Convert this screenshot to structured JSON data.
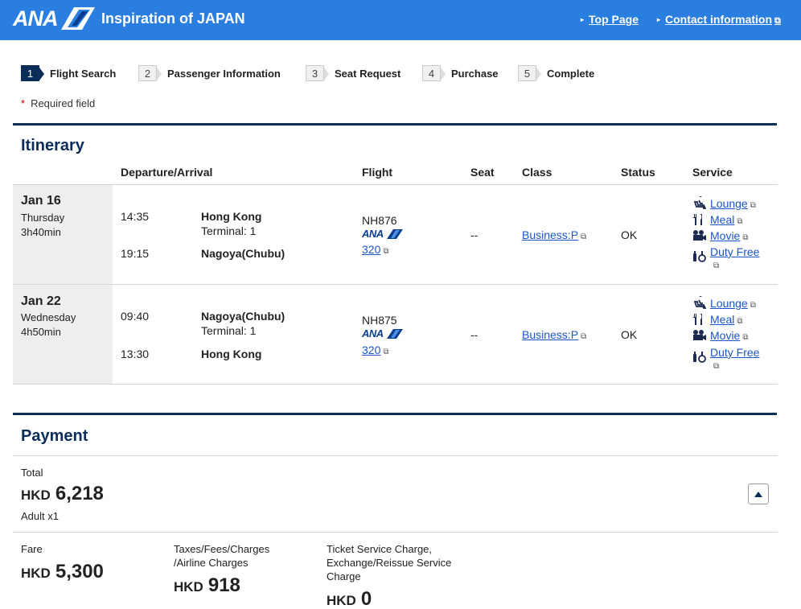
{
  "header": {
    "logo_text": "ANA",
    "tagline": "Inspiration of JAPAN",
    "links": {
      "top_page": "Top Page",
      "contact": "Contact information"
    }
  },
  "steps": [
    {
      "num": "1",
      "label": "Flight Search"
    },
    {
      "num": "2",
      "label": "Passenger Information"
    },
    {
      "num": "3",
      "label": "Seat Request"
    },
    {
      "num": "4",
      "label": "Purchase"
    },
    {
      "num": "5",
      "label": "Complete"
    }
  ],
  "required_note": {
    "star": "*",
    "text": "Required field"
  },
  "itinerary": {
    "title": "Itinerary",
    "headers": {
      "dep_arr": "Departure/Arrival",
      "flight": "Flight",
      "seat": "Seat",
      "class": "Class",
      "status": "Status",
      "service": "Service"
    },
    "segments": [
      {
        "date": "Jan 16",
        "day": "Thursday",
        "duration": "3h40min",
        "dep_time": "14:35",
        "dep_city": "Hong Kong",
        "terminal": "Terminal: 1",
        "arr_time": "19:15",
        "arr_city": "Nagoya(Chubu)",
        "flight_no": "NH876",
        "carrier_logo": "ANA",
        "aircraft": "320",
        "seat": "--",
        "class": "Business:P",
        "status": "OK",
        "services": [
          "Lounge",
          "Meal",
          "Movie",
          "Duty Free"
        ]
      },
      {
        "date": "Jan 22",
        "day": "Wednesday",
        "duration": "4h50min",
        "dep_time": "09:40",
        "dep_city": "Nagoya(Chubu)",
        "terminal": "Terminal: 1",
        "arr_time": "13:30",
        "arr_city": "Hong Kong",
        "flight_no": "NH875",
        "carrier_logo": "ANA",
        "aircraft": "320",
        "seat": "--",
        "class": "Business:P",
        "status": "OK",
        "services": [
          "Lounge",
          "Meal",
          "Movie",
          "Duty Free"
        ]
      }
    ]
  },
  "payment": {
    "title": "Payment",
    "total_label": "Total",
    "total_currency": "HKD",
    "total_amount": "6,218",
    "passengers": "Adult x1",
    "fare_label": "Fare",
    "fare_currency": "HKD",
    "fare_amount": "5,300",
    "taxes_label_1": "Taxes/Fees/Charges",
    "taxes_label_2": "/Airline Charges",
    "taxes_currency": "HKD",
    "taxes_amount": "918",
    "service_label_1": "Ticket Service Charge,",
    "service_label_2": "Exchange/Reissue Service",
    "service_label_3": "Charge",
    "service_currency": "HKD",
    "service_amount": "0"
  },
  "colors": {
    "header_bg": "#2a7ee0",
    "navy": "#0b2d5a",
    "link": "#1a55c7",
    "date_bg": "#eeeeee"
  },
  "icons": [
    "external-link-icon",
    "lounge-icon",
    "meal-icon",
    "movie-icon",
    "duty-free-icon",
    "collapse-icon"
  ]
}
